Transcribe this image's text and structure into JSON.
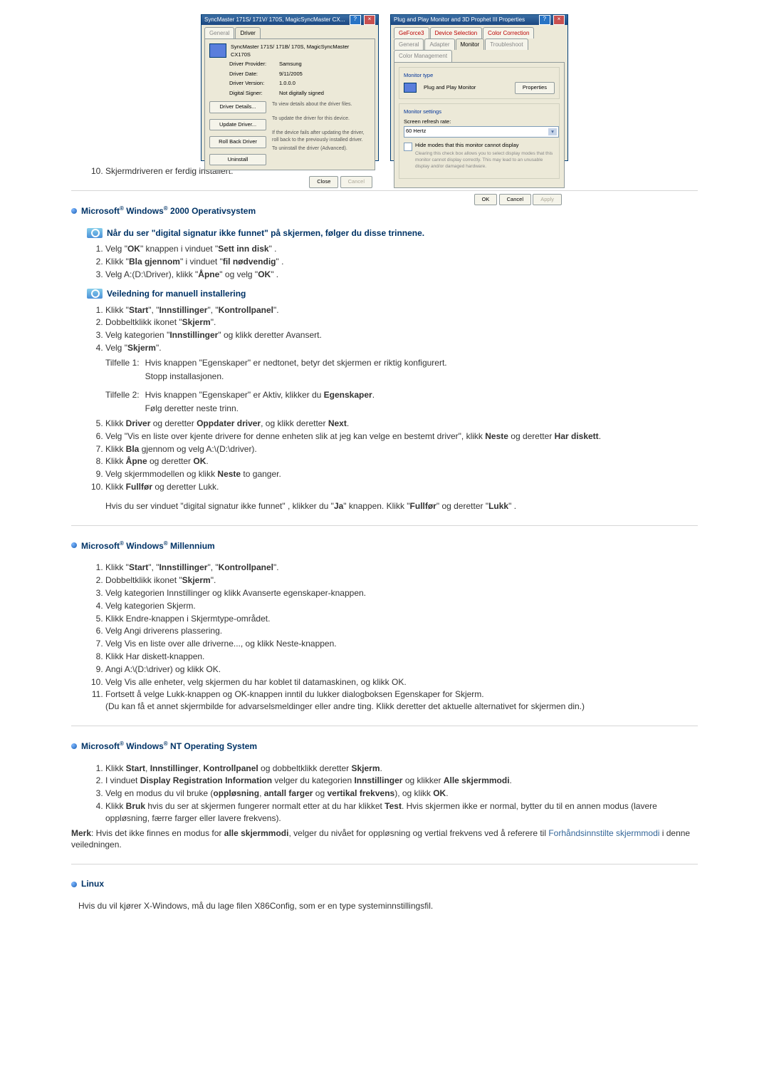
{
  "dialog1": {
    "title": "SyncMaster 171S/ 171V/ 170S, MagicSyncMaster CX...",
    "tab_general": "General",
    "tab_driver": "Driver",
    "device_name": "SyncMaster 171S/ 171B/ 170S, MagicSyncMaster CX170S",
    "provider_lbl": "Driver Provider:",
    "provider_val": "Samsung",
    "date_lbl": "Driver Date:",
    "date_val": "9/11/2005",
    "version_lbl": "Driver Version:",
    "version_val": "1.0.0.0",
    "signer_lbl": "Digital Signer:",
    "signer_val": "Not digitally signed",
    "btn_details": "Driver Details...",
    "desc_details": "To view details about the driver files.",
    "btn_update": "Update Driver...",
    "desc_update": "To update the driver for this device.",
    "btn_rollback": "Roll Back Driver",
    "desc_rollback": "If the device fails after updating the driver, roll back to the previously installed driver.",
    "btn_uninstall": "Uninstall",
    "desc_uninstall": "To uninstall the driver (Advanced).",
    "btn_close": "Close",
    "btn_cancel": "Cancel"
  },
  "dialog2": {
    "title": "Plug and Play Monitor and 3D Prophet III Properties",
    "tabs": [
      "GeForce3",
      "Device Selection",
      "Color Correction",
      "General",
      "Adapter",
      "Monitor",
      "Troubleshoot",
      "Color Management"
    ],
    "gb_type": "Monitor type",
    "type_val": "Plug and Play Monitor",
    "btn_props": "Properties",
    "gb_settings": "Monitor settings",
    "refresh_lbl": "Screen refresh rate:",
    "refresh_val": "60 Hertz",
    "hide_modes": "Hide modes that this monitor cannot display",
    "hide_desc": "Clearing this check box allows you to select display modes that this monitor cannot display correctly. This may lead to an unusable display and/or damaged hardware.",
    "btn_ok": "OK",
    "btn_cancel": "Cancel",
    "btn_apply": "Apply"
  },
  "step10": "Skjermdriveren er ferdig installert.",
  "sec_2000": "Microsoft® Windows® 2000 Operativsystem",
  "sub_sig": "Når du ser \"digital signatur ikke funnet\" på skjermen, følger du disse trinnene.",
  "steps_sig": [
    "Velg \"OK\" knappen i vinduet \"Sett inn disk\" .",
    "Klikk \"Bla gjennom\" i vinduet \"fil nødvendig\" .",
    "Velg A:(D:\\Driver), klikk \"Åpne\" og velg \"OK\" ."
  ],
  "sub_manual": "Veiledning for manuell installering",
  "steps_manual_a": [
    "Klikk \"Start\", \"Innstillinger\", \"Kontrollpanel\".",
    "Dobbeltklikk ikonet \"Skjerm\".",
    "Velg kategorien \"Innstillinger\" og klikk deretter Avansert.",
    "Velg \"Skjerm\"."
  ],
  "tilfelle1_lbl": "Tilfelle 1:",
  "tilfelle1_a": "Hvis knappen \"Egenskaper\" er nedtonet, betyr det skjermen er riktig konfigurert.",
  "tilfelle1_b": "Stopp installasjonen.",
  "tilfelle2_lbl": "Tilfelle 2:",
  "tilfelle2_a": "Hvis knappen \"Egenskaper\" er Aktiv, klikker du Egenskaper.",
  "tilfelle2_b": "Følg deretter neste trinn.",
  "steps_manual_b": [
    "Klikk Driver og deretter Oppdater driver, og klikk deretter Next.",
    "Velg \"Vis en liste over kjente drivere for denne enheten slik at jeg kan velge en bestemt driver\", klikk Neste og deretter Har diskett.",
    "Klikk Bla gjennom og velg A:\\(D:\\driver).",
    "Klikk Åpne og deretter OK.",
    "Velg skjermmodellen og klikk Neste to ganger.",
    "Klikk Fullfør og deretter Lukk."
  ],
  "note_2000": "Hvis du ser vinduet \"digital signatur ikke funnet\" , klikker du \"Ja\" knappen. Klikk \"Fullfør\" og deretter \"Lukk\" .",
  "sec_me": "Microsoft® Windows® Millennium",
  "steps_me": [
    "Klikk \"Start\", \"Innstillinger\", \"Kontrollpanel\".",
    "Dobbeltklikk ikonet \"Skjerm\".",
    "Velg kategorien Innstillinger og klikk Avanserte egenskaper-knappen.",
    "Velg kategorien Skjerm.",
    "Klikk Endre-knappen i Skjermtype-området.",
    "Velg Angi driverens plassering.",
    "Velg Vis en liste over alle driverne..., og klikk Neste-knappen.",
    "Klikk Har diskett-knappen.",
    "Angi A:\\(D:\\driver) og klikk OK.",
    "Velg Vis alle enheter, velg skjermen du har koblet til datamaskinen, og klikk OK.",
    "Fortsett å velge Lukk-knappen og OK-knappen inntil du lukker dialogboksen Egenskaper for Skjerm."
  ],
  "me_paren": "(Du kan få et annet skjermbilde for advarselsmeldinger eller andre ting. Klikk deretter det aktuelle alternativet for skjermen din.)",
  "sec_nt": "Microsoft® Windows® NT Operating System",
  "steps_nt": [
    "Klikk Start, Innstillinger, Kontrollpanel og dobbeltklikk deretter Skjerm.",
    "I vinduet Display Registration Information velger du kategorien Innstillinger og klikker Alle skjermmodi.",
    "Velg en modus du vil bruke (oppløsning, antall farger og vertikal frekvens), og klikk OK.",
    "Klikk Bruk hvis du ser at skjermen fungerer normalt etter at du har klikket Test. Hvis skjermen ikke er normal, bytter du til en annen modus (lavere oppløsning, færre farger eller lavere frekvens)."
  ],
  "merk_lbl": "Merk",
  "merk_txt_a": ": Hvis det ikke finnes en modus for alle skjermmodi, velger du nivået for oppløsning og vertial frekvens ved å referere til ",
  "merk_link": "Forhåndsinnstilte skjermmodi",
  "merk_txt_b": " i denne veiledningen.",
  "sec_linux": "Linux",
  "linux_p": "Hvis du vil kjører X-Windows, må du lage filen X86Config, som er en type systeminnstillingsfil."
}
